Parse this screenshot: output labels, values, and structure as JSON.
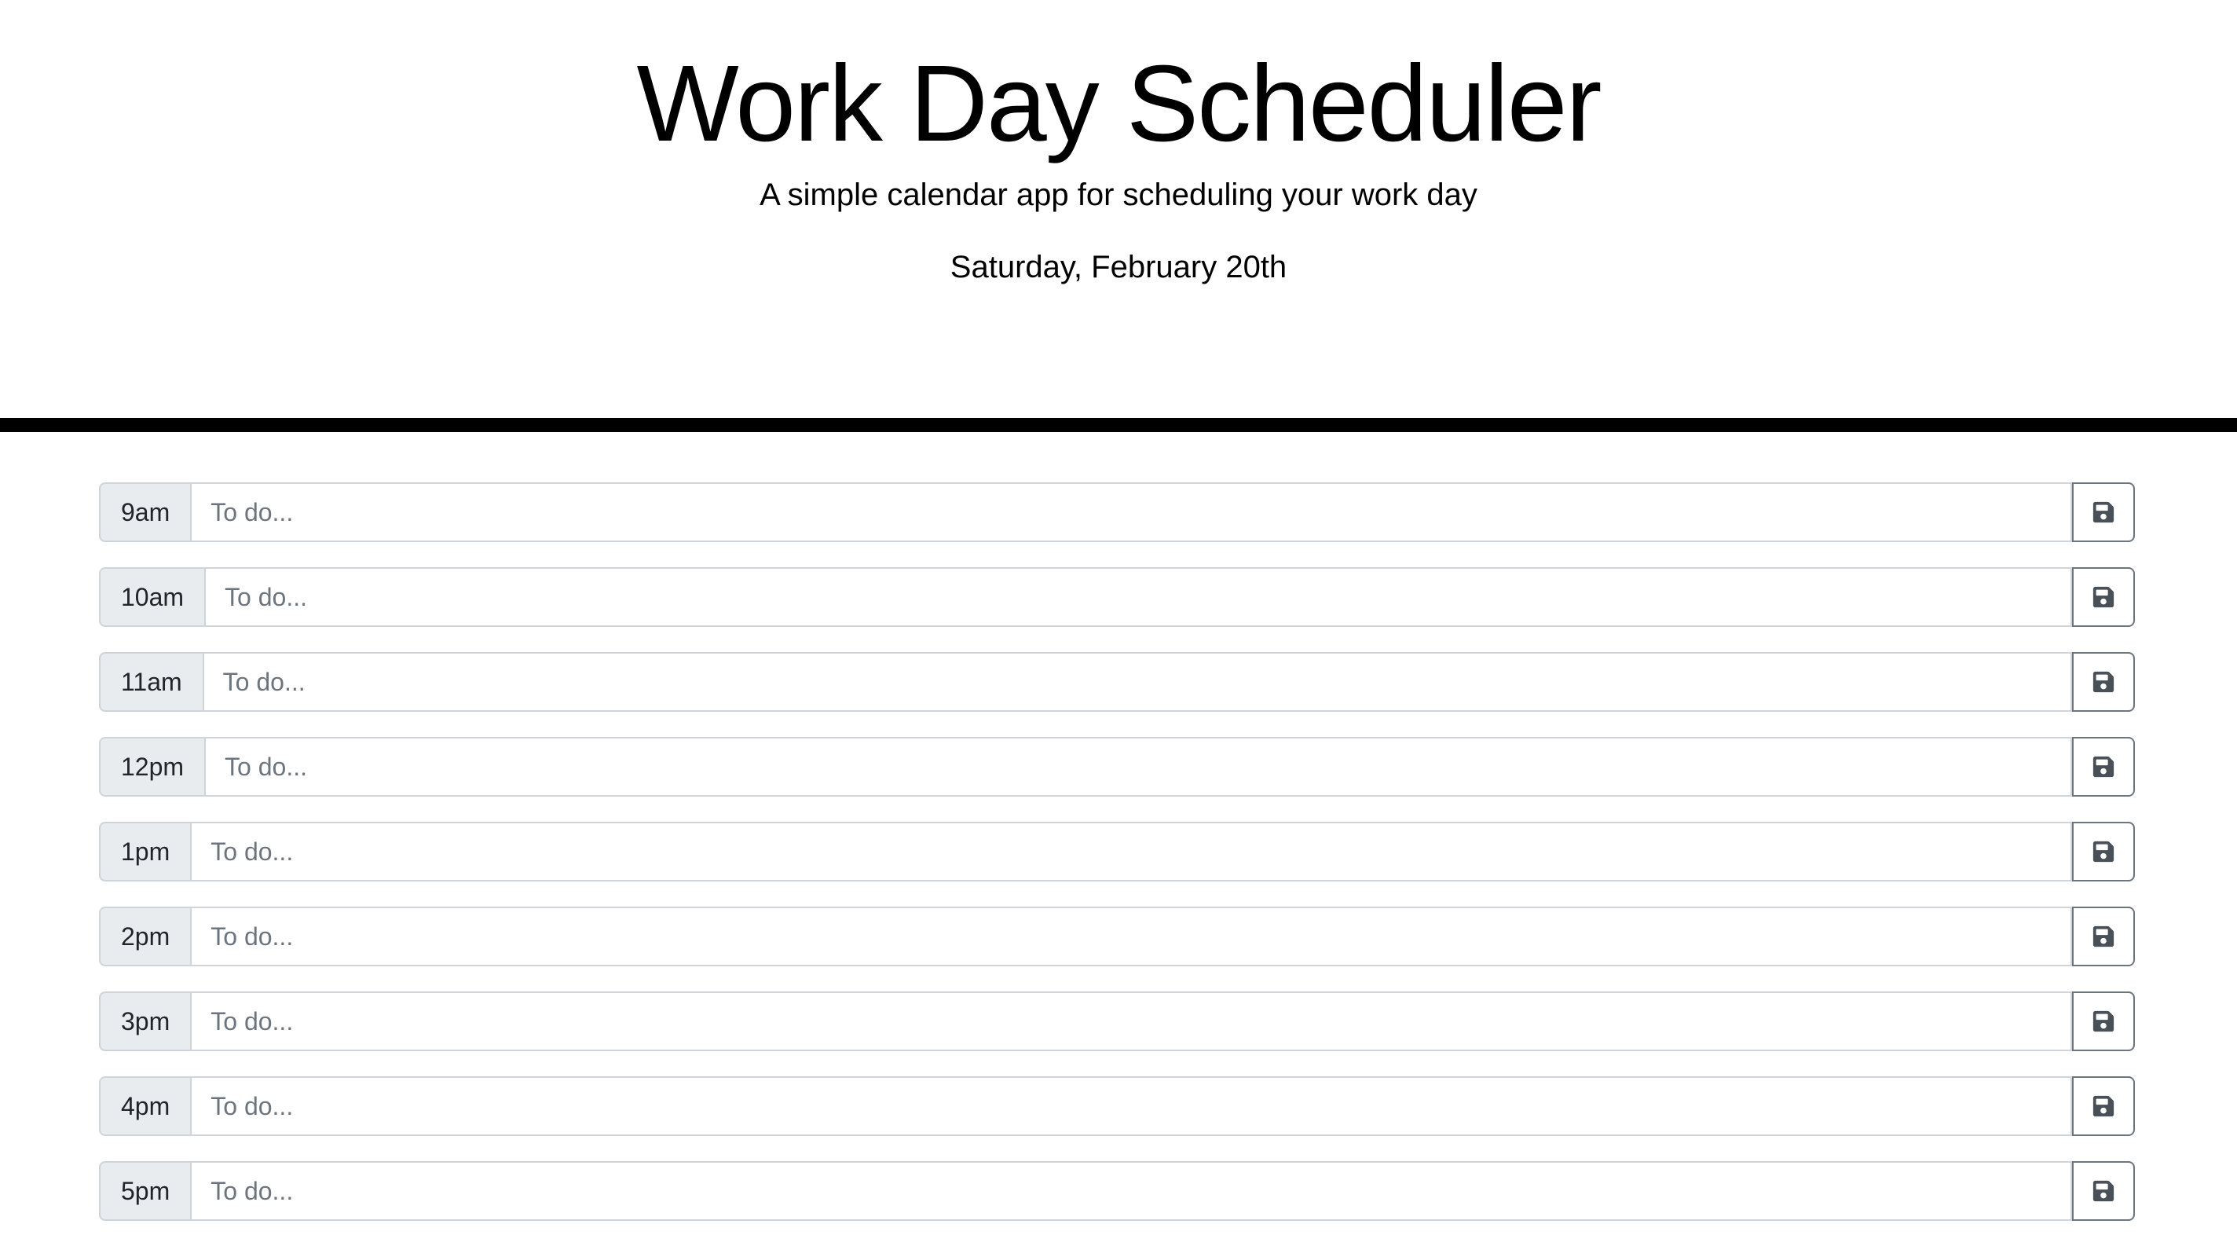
{
  "header": {
    "title": "Work Day Scheduler",
    "subtitle": "A simple calendar app for scheduling your work day",
    "current_day": "Saturday, February 20th"
  },
  "schedule": {
    "placeholder": "To do...",
    "save_icon": "floppy-disk-icon",
    "rows": [
      {
        "hour": "9am",
        "value": ""
      },
      {
        "hour": "10am",
        "value": ""
      },
      {
        "hour": "11am",
        "value": ""
      },
      {
        "hour": "12pm",
        "value": ""
      },
      {
        "hour": "1pm",
        "value": ""
      },
      {
        "hour": "2pm",
        "value": ""
      },
      {
        "hour": "3pm",
        "value": ""
      },
      {
        "hour": "4pm",
        "value": ""
      },
      {
        "hour": "5pm",
        "value": ""
      }
    ]
  },
  "colors": {
    "divider": "#000000",
    "hour_bg": "#e9ecef",
    "border": "#ced4da",
    "save_border": "#6c757d",
    "icon": "#495057"
  }
}
